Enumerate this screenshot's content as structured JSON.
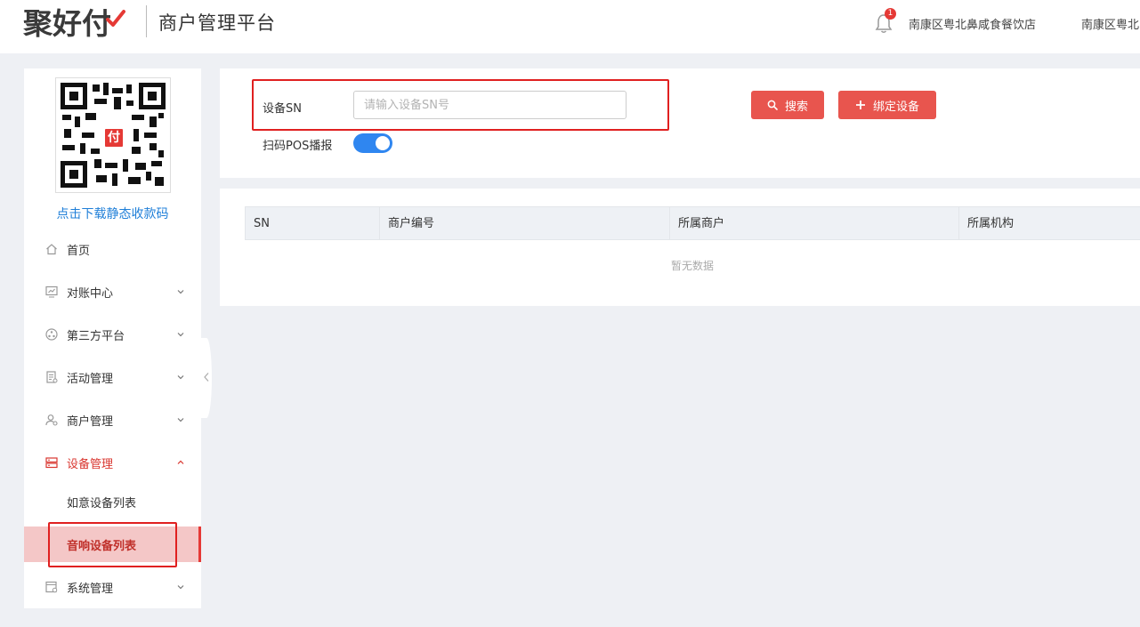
{
  "header": {
    "logo_text": "聚好付",
    "platform_title": "商户管理平台",
    "notification_count": "1",
    "shop_name_1": "南康区粤北鼻咸食餐饮店",
    "shop_name_2": "南康区粤北"
  },
  "sidebar": {
    "qr_logo_char": "付",
    "qr_download_label": "点击下载静态收款码",
    "items": [
      {
        "label": "首页",
        "icon": "home-icon"
      },
      {
        "label": "对账中心",
        "icon": "monitor-icon"
      },
      {
        "label": "第三方平台",
        "icon": "share-icon"
      },
      {
        "label": "活动管理",
        "icon": "document-icon"
      },
      {
        "label": "商户管理",
        "icon": "user-settings-icon"
      },
      {
        "label": "设备管理",
        "icon": "device-icon"
      },
      {
        "label": "系统管理",
        "icon": "settings-window-icon"
      }
    ],
    "device_submenu": [
      {
        "label": "如意设备列表"
      },
      {
        "label": "音响设备列表"
      }
    ]
  },
  "search": {
    "sn_label": "设备SN",
    "sn_placeholder": "请输入设备SN号",
    "search_button": "搜索",
    "bind_button": "绑定设备",
    "pos_broadcast_label": "扫码POS播报",
    "pos_broadcast_on": true
  },
  "table": {
    "columns": [
      "SN",
      "商户编号",
      "所属商户",
      "所属机构"
    ],
    "empty_text": "暂无数据"
  },
  "colors": {
    "brand_red": "#e8554e",
    "toggle_blue": "#2f86f0",
    "link_blue": "#1f7fd8",
    "highlight_red": "#e02020"
  }
}
